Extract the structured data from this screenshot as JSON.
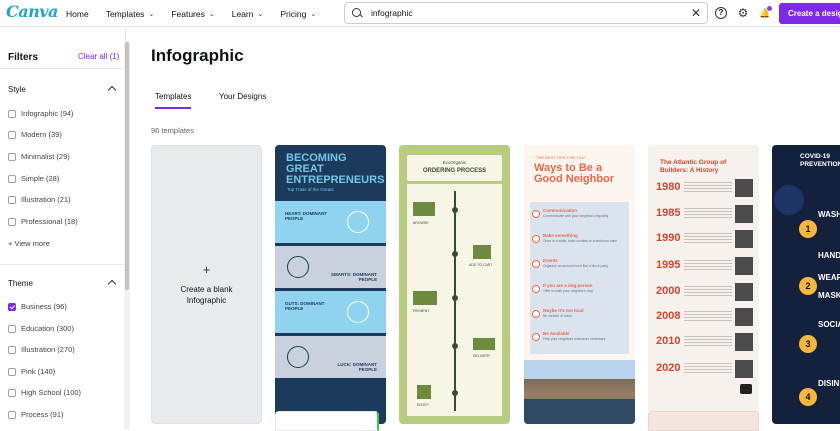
{
  "topbar": {
    "logo": "Canva",
    "nav": [
      {
        "label": "Home",
        "has_menu": false
      },
      {
        "label": "Templates",
        "has_menu": true
      },
      {
        "label": "Features",
        "has_menu": true
      },
      {
        "label": "Learn",
        "has_menu": true
      },
      {
        "label": "Pricing",
        "has_menu": true
      }
    ],
    "search_value": "infographic",
    "help_icon_glyph": "?",
    "gear_icon_glyph": "⚙",
    "bell_icon_glyph": "🔔",
    "create_button": "Create a design"
  },
  "sidebar": {
    "title": "Filters",
    "clear_all": "Clear all (1)",
    "style": {
      "heading": "Style",
      "options": [
        {
          "label": "Infographic (94)",
          "checked": false
        },
        {
          "label": "Modern (39)",
          "checked": false
        },
        {
          "label": "Minimalist (29)",
          "checked": false
        },
        {
          "label": "Simple (28)",
          "checked": false
        },
        {
          "label": "Illustration (21)",
          "checked": false
        },
        {
          "label": "Professional (18)",
          "checked": false
        }
      ],
      "view_more": "+ View more"
    },
    "theme": {
      "heading": "Theme",
      "options": [
        {
          "label": "Business (96)",
          "checked": true
        },
        {
          "label": "Education (300)",
          "checked": false
        },
        {
          "label": "Illustration (270)",
          "checked": false
        },
        {
          "label": "Pink (140)",
          "checked": false
        },
        {
          "label": "High School (100)",
          "checked": false
        },
        {
          "label": "Process (91)",
          "checked": false
        }
      ]
    }
  },
  "main": {
    "title": "Infographic",
    "tabs": [
      {
        "label": "Templates",
        "active": true
      },
      {
        "label": "Your Designs",
        "active": false
      }
    ],
    "count": "96 templates",
    "blank": {
      "plus": "+",
      "line1": "Create a blank",
      "line2": "Infographic"
    }
  },
  "templates": {
    "t1": {
      "title": "BECOMING GREAT ENTREPRENEURS",
      "subtitle": "Top Traits of the Greats",
      "bands": [
        "HEART: DOMINANT PEOPLE",
        "SMARTS: DOMINANT PEOPLE",
        "GUTS: DOMINANT PEOPLE",
        "LUCK: DOMINANT PEOPLE"
      ]
    },
    "t2": {
      "brand": "EcoOrganic",
      "title": "ORDERING PROCESS",
      "steps": [
        "BROWSE",
        "ADD TO CART",
        "PAYMENT",
        "DELIVERY",
        "ENJOY"
      ]
    },
    "t3": {
      "kicker": "THE BEST TIPS FOR YOU",
      "title": "Ways to Be a Good Neighbor",
      "tips": [
        {
          "title": "Communication",
          "text": "Communicate with your neighbors regularly"
        },
        {
          "title": "Bake something",
          "text": "Once in a while, bake cookies or a welcome cake"
        },
        {
          "title": "Events",
          "text": "Organize an annual event like a block party"
        },
        {
          "title": "If you are a dog person",
          "text": "Offer to walk your neighbor's dog"
        },
        {
          "title": "Maybe it's too loud",
          "text": "Be mindful of noise"
        },
        {
          "title": "Be Available",
          "text": "Help your neighbors whenever necessary"
        }
      ]
    },
    "t4": {
      "title": "The Atlantic Group of Builders: A History",
      "years": [
        "1980",
        "1985",
        "1990",
        "1995",
        "2000",
        "2008",
        "2010",
        "2020"
      ]
    },
    "t5": {
      "title": "COVID-19 PREVENTION",
      "words": [
        "WASH",
        "HANDS",
        "WEAR",
        "MASK",
        "SOCIAL",
        "DISINFECT"
      ],
      "steps": [
        "1",
        "2",
        "3",
        "4"
      ]
    }
  },
  "colors": {
    "accent": "#7d2ae8",
    "logo": "#1fa6c9"
  }
}
